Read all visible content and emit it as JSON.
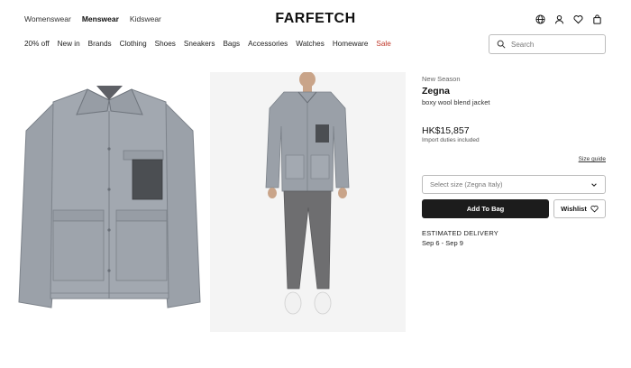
{
  "header": {
    "gender_tabs": [
      "Womenswear",
      "Menswear",
      "Kidswear"
    ],
    "active_gender": "Menswear",
    "logo": "FARFETCH",
    "icons": [
      "globe-icon",
      "account-icon",
      "heart-icon",
      "bag-icon"
    ]
  },
  "nav": {
    "items": [
      "20% off",
      "New in",
      "Brands",
      "Clothing",
      "Shoes",
      "Sneakers",
      "Bags",
      "Accessories",
      "Watches",
      "Homeware",
      "Sale"
    ]
  },
  "search": {
    "placeholder": "Search"
  },
  "product": {
    "season": "New Season",
    "brand": "Zegna",
    "name": "boxy wool blend jacket",
    "price": "HK$15,857",
    "duties": "Import duties included",
    "size_guide": "Size guide",
    "size_select": "Select size (Zegna Italy)",
    "add_to_bag": "Add To Bag",
    "wishlist": "Wishlist",
    "delivery_label": "ESTIMATED DELIVERY",
    "delivery_date": "Sep 6 - Sep 9"
  },
  "colors": {
    "accent": "#1c1c1c",
    "sale": "#c0392b",
    "jacket": "#9aa0a8",
    "trousers": "#6e6e70"
  }
}
